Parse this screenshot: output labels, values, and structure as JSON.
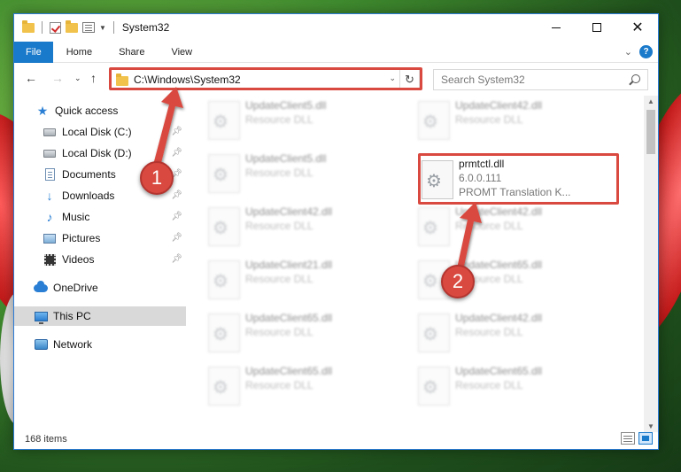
{
  "window": {
    "title": "System32",
    "controls": {
      "minimize": "minimize",
      "maximize": "maximize",
      "close": "✕"
    }
  },
  "ribbon": {
    "tabs": [
      "File",
      "Home",
      "Share",
      "View"
    ],
    "help": "?"
  },
  "address": {
    "path": "C:\\Windows\\System32",
    "search_placeholder": "Search System32"
  },
  "sidebar": {
    "items": [
      {
        "label": "Quick access",
        "icon": "star-icon",
        "pinned": false
      },
      {
        "label": "Local Disk (C:)",
        "icon": "drive-icon",
        "pinned": true
      },
      {
        "label": "Local Disk (D:)",
        "icon": "drive-icon",
        "pinned": true
      },
      {
        "label": "Documents",
        "icon": "documents-icon",
        "pinned": true
      },
      {
        "label": "Downloads",
        "icon": "download-icon",
        "pinned": true
      },
      {
        "label": "Music",
        "icon": "music-icon",
        "pinned": true
      },
      {
        "label": "Pictures",
        "icon": "pictures-icon",
        "pinned": true
      },
      {
        "label": "Videos",
        "icon": "videos-icon",
        "pinned": true
      },
      {
        "label": "OneDrive",
        "icon": "onedrive-icon",
        "pinned": false
      },
      {
        "label": "This PC",
        "icon": "this-pc-icon",
        "pinned": false,
        "selected": true
      },
      {
        "label": "Network",
        "icon": "network-icon",
        "pinned": false
      }
    ]
  },
  "files": {
    "left_column": [
      {
        "name": "UpdateClient5.dll",
        "type": "Resource DLL"
      },
      {
        "name": "UpdateClient5.dll",
        "type": "Resource DLL"
      },
      {
        "name": "UpdateClient42.dll",
        "type": "Resource DLL"
      },
      {
        "name": "UpdateClient21.dll",
        "type": "Resource DLL"
      },
      {
        "name": "UpdateClient65.dll",
        "type": "Resource DLL"
      },
      {
        "name": "UpdateClient65.dll",
        "type": "Resource DLL"
      }
    ],
    "right_column": [
      {
        "name": "UpdateClient42.dll",
        "type": "Resource DLL"
      },
      {
        "name": "prmtctl.dll",
        "version": "6.0.0.111",
        "type": "PROMT Translation K...",
        "highlighted": true
      },
      {
        "name": "UpdateClient42.dll",
        "type": "Resource DLL"
      },
      {
        "name": "UpdateClient65.dll",
        "type": "Resource DLL"
      },
      {
        "name": "UpdateClient42.dll",
        "type": "Resource DLL"
      },
      {
        "name": "UpdateClient65.dll",
        "type": "Resource DLL"
      }
    ]
  },
  "status": {
    "item_count": "168 items"
  },
  "markers": [
    {
      "number": "1"
    },
    {
      "number": "2"
    }
  ],
  "colors": {
    "accent": "#1979ca",
    "highlight": "#d9493f"
  }
}
